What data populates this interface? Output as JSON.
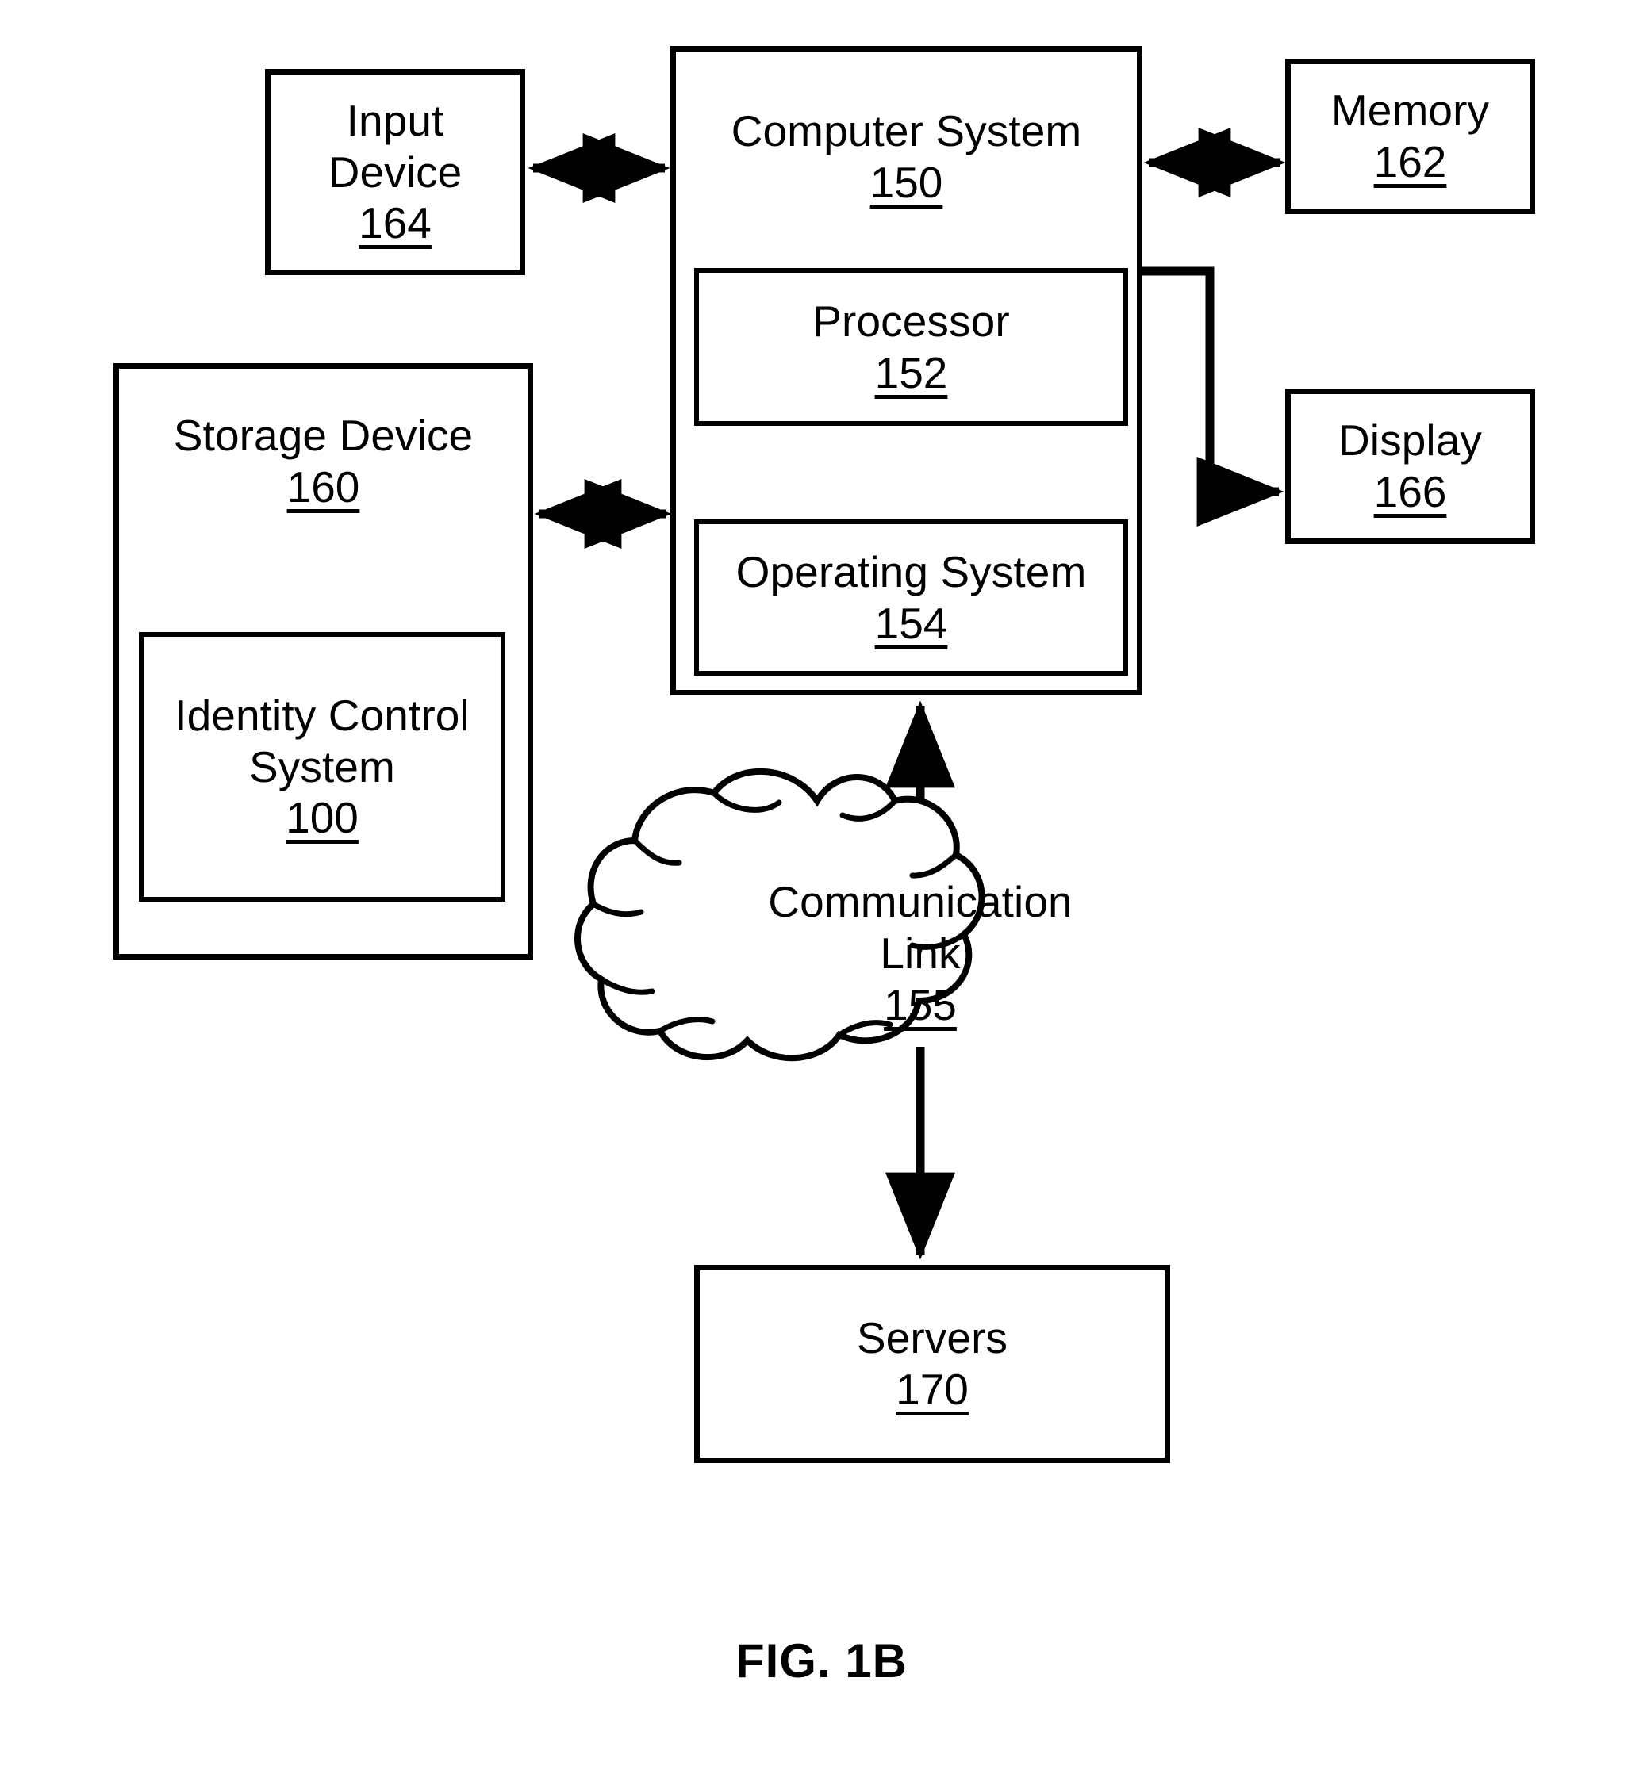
{
  "figure": {
    "caption": "FIG. 1B",
    "line_color": "#000000",
    "background_color": "#ffffff"
  },
  "nodes": {
    "input_device": {
      "label": "Input\nDevice",
      "ref": "164"
    },
    "computer_system": {
      "label": "Computer System",
      "ref": "150"
    },
    "memory": {
      "label": "Memory",
      "ref": "162"
    },
    "display": {
      "label": "Display",
      "ref": "166"
    },
    "storage_device": {
      "label": "Storage Device",
      "ref": "160"
    },
    "identity_control_system": {
      "label": "Identity Control\nSystem",
      "ref": "100"
    },
    "processor": {
      "label": "Processor",
      "ref": "152"
    },
    "operating_system": {
      "label": "Operating System",
      "ref": "154"
    },
    "communication_link": {
      "label": "Communication\nLink",
      "ref": "155"
    },
    "servers": {
      "label": "Servers",
      "ref": "170"
    }
  },
  "connectors": [
    {
      "name": "input-device-to-computer-system",
      "from": "input_device",
      "to": "computer_system",
      "style": "double-arrow",
      "orientation": "horizontal"
    },
    {
      "name": "computer-system-to-memory",
      "from": "computer_system",
      "to": "memory",
      "style": "double-arrow",
      "orientation": "horizontal"
    },
    {
      "name": "computer-system-to-display",
      "from": "computer_system",
      "to": "display",
      "style": "single-arrow",
      "orientation": "elbow"
    },
    {
      "name": "storage-device-to-computer-system",
      "from": "storage_device",
      "to": "computer_system",
      "style": "double-arrow",
      "orientation": "horizontal"
    },
    {
      "name": "communication-link-to-computer-system",
      "from": "communication_link",
      "to": "computer_system",
      "style": "single-arrow",
      "orientation": "vertical"
    },
    {
      "name": "communication-link-to-servers",
      "from": "communication_link",
      "to": "servers",
      "style": "single-arrow",
      "orientation": "vertical"
    }
  ]
}
